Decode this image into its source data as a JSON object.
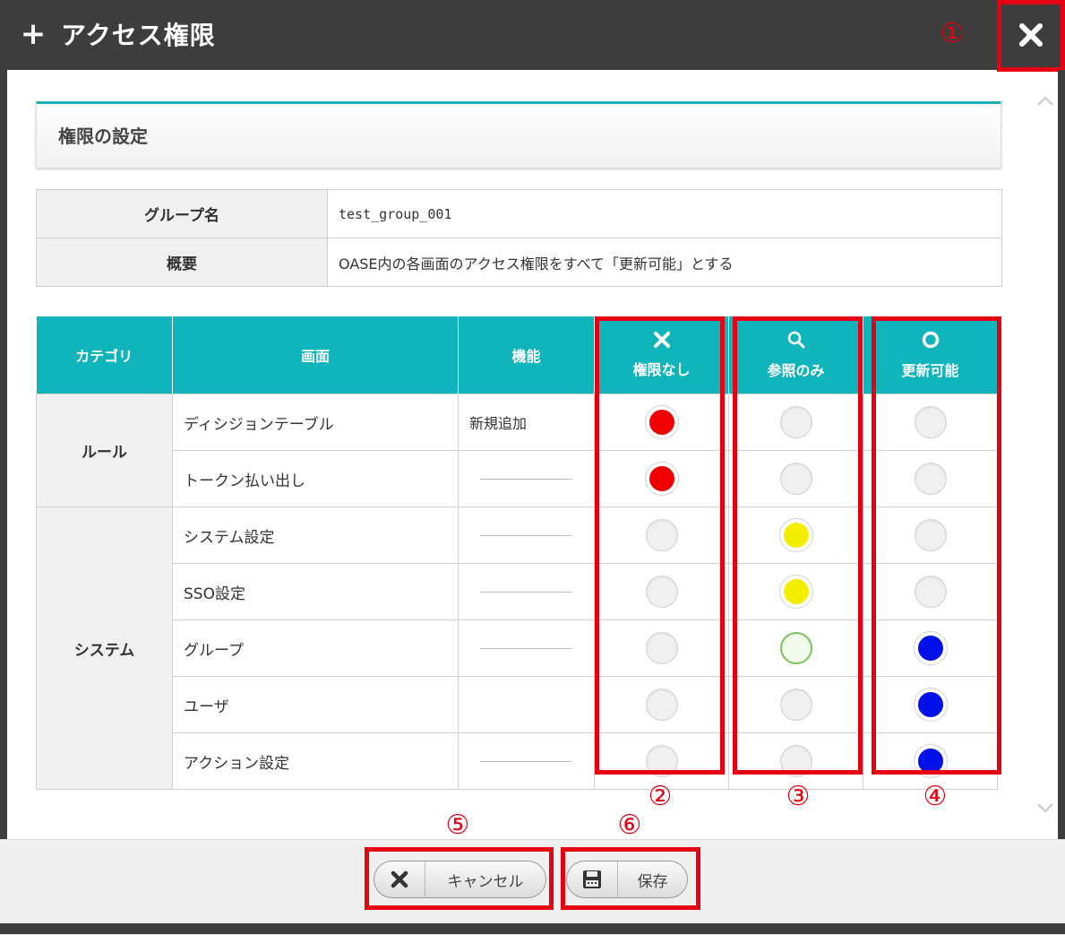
{
  "titlebar": {
    "plus": "+",
    "title": "アクセス権限"
  },
  "section": {
    "title": "権限の設定"
  },
  "info": {
    "group_label": "グループ名",
    "group_value": "test_group_001",
    "summary_label": "概要",
    "summary_value": "OASE内の各画面のアクセス権限をすべて「更新可能」とする"
  },
  "perm_table": {
    "headers": {
      "category": "カテゴリ",
      "screen": "画面",
      "function": "機能",
      "none": "権限なし",
      "view": "参照のみ",
      "update": "更新可能"
    },
    "categories": [
      "ルール",
      "システム"
    ],
    "rows": [
      {
        "screen": "ディシジョンテーブル",
        "function": "新規追加",
        "selected": "none"
      },
      {
        "screen": "トークン払い出し",
        "function": "",
        "selected": "none"
      },
      {
        "screen": "システム設定",
        "function": "",
        "selected": "view"
      },
      {
        "screen": "SSO設定",
        "function": "",
        "selected": "view"
      },
      {
        "screen": "グループ",
        "function": "",
        "selected": "update"
      },
      {
        "screen": "ユーザ",
        "function": "",
        "selected": "update"
      },
      {
        "screen": "アクション設定",
        "function": "",
        "selected": "update"
      }
    ]
  },
  "buttons": {
    "cancel": "キャンセル",
    "save": "保存"
  },
  "annotations": [
    "①",
    "②",
    "③",
    "④",
    "⑤",
    "⑥"
  ],
  "colors": {
    "accent": "#10b4bb",
    "none": "#f00000",
    "view": "#f4ef00",
    "update": "#0010e8",
    "annotation": "#e60012"
  }
}
